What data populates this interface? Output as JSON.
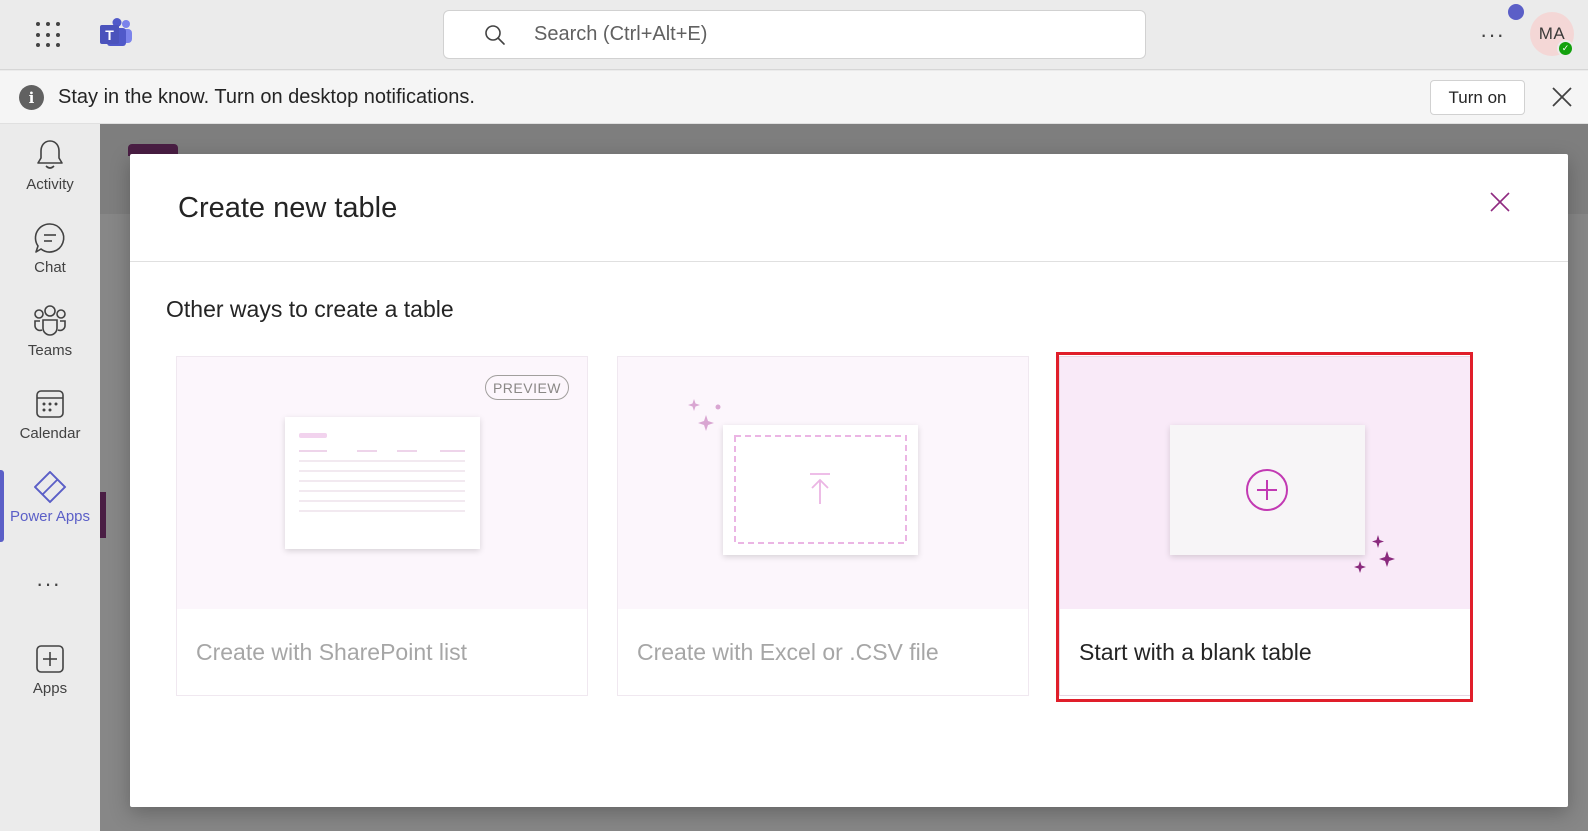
{
  "topbar": {
    "search_placeholder": "Search (Ctrl+Alt+E)",
    "more_label": "···",
    "avatar_initials": "MA",
    "brand_color": "#5b5fc7"
  },
  "banner": {
    "message": "Stay in the know. Turn on desktop notifications.",
    "turn_on_label": "Turn on"
  },
  "rail": {
    "items": [
      {
        "label": "Activity",
        "icon": "bell-icon"
      },
      {
        "label": "Chat",
        "icon": "chat-icon"
      },
      {
        "label": "Teams",
        "icon": "teams-icon"
      },
      {
        "label": "Calendar",
        "icon": "calendar-icon"
      },
      {
        "label": "Power Apps",
        "icon": "power-apps-icon",
        "active": true
      },
      {
        "label": "Apps",
        "icon": "add-apps-icon"
      }
    ],
    "more_label": "···"
  },
  "modal": {
    "title": "Create new table",
    "section_title": "Other ways to create a table",
    "cards": [
      {
        "label": "Create with SharePoint list",
        "badge": "PREVIEW",
        "enabled": false
      },
      {
        "label": "Create with Excel or .CSV file",
        "enabled": false
      },
      {
        "label": "Start with a blank table",
        "enabled": true,
        "highlighted": true
      }
    ],
    "accent_color": "#c239b3",
    "highlight_color": "#e01e2a"
  }
}
